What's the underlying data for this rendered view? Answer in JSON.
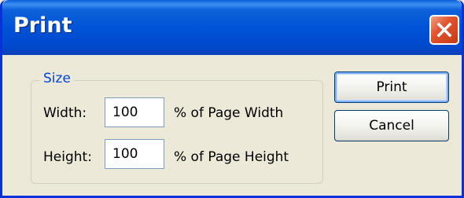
{
  "window": {
    "title": "Print",
    "close_icon": "close-icon"
  },
  "size_group": {
    "legend": "Size",
    "width": {
      "label": "Width:",
      "value": "100",
      "unit": "% of Page Width"
    },
    "height": {
      "label": "Height:",
      "value": "100",
      "unit": "% of Page Height"
    }
  },
  "buttons": {
    "print": "Print",
    "cancel": "Cancel"
  },
  "colors": {
    "titlebar": "#0052d6",
    "close_button": "#e2542f",
    "dialog_background": "#ece9d8",
    "group_label": "#0046d5"
  }
}
